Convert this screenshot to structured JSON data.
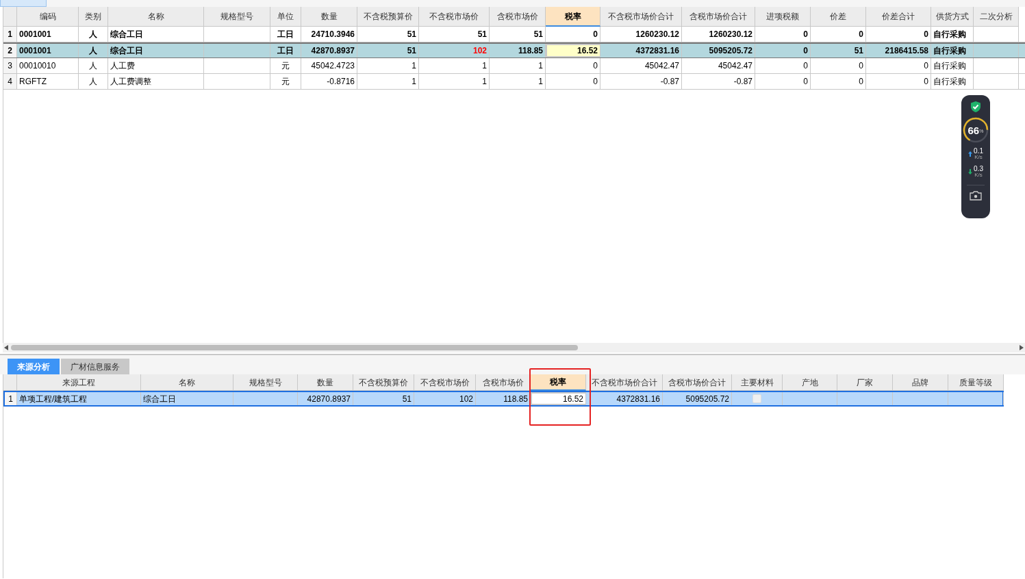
{
  "main_table": {
    "columns": [
      {
        "selected": false
      },
      {
        "label": "编码",
        "selected": false
      },
      {
        "label": "类别",
        "selected": false
      },
      {
        "label": "名称",
        "selected": false
      },
      {
        "label": "规格型号",
        "selected": false
      },
      {
        "label": "单位",
        "selected": false
      },
      {
        "label": "数量",
        "selected": false
      },
      {
        "label": "不含税预算价",
        "selected": false
      },
      {
        "label": "不含税市场价",
        "selected": false
      },
      {
        "label": "含税市场价",
        "selected": false
      },
      {
        "label": "税率",
        "selected": true
      },
      {
        "label": "不含税市场价合计",
        "selected": false
      },
      {
        "label": "含税市场价合计",
        "selected": false
      },
      {
        "label": "进项税额",
        "selected": false
      },
      {
        "label": "价差",
        "selected": false
      },
      {
        "label": "价差合计",
        "selected": false
      },
      {
        "label": "供货方式",
        "selected": false
      },
      {
        "label": "二次分析",
        "selected": false
      }
    ],
    "rows": [
      {
        "selected": false,
        "bold": true,
        "cells": [
          "1",
          "0001001",
          "人",
          "综合工日",
          "",
          "工日",
          "24710.3946",
          "51",
          "51",
          "51",
          "0",
          "1260230.12",
          "1260230.12",
          "0",
          "0",
          "0",
          "自行采购",
          ""
        ]
      },
      {
        "selected": true,
        "bold": true,
        "cells": [
          "2",
          "0001001",
          "人",
          "综合工日",
          "",
          "工日",
          "42870.8937",
          "51",
          {
            "text": "102",
            "color": "#ff0000"
          },
          "118.85",
          "16.52",
          "4372831.16",
          "5095205.72",
          "0",
          "51",
          "2186415.58",
          "自行采购",
          ""
        ]
      },
      {
        "selected": false,
        "bold": false,
        "cells": [
          "3",
          "00010010",
          "人",
          "人工费",
          "",
          "元",
          "45042.4723",
          "1",
          "1",
          "1",
          "0",
          "45042.47",
          "45042.47",
          "0",
          "0",
          "0",
          "自行采购",
          ""
        ]
      },
      {
        "selected": false,
        "bold": false,
        "cells": [
          "4",
          "RGFTZ",
          "人",
          "人工费调整",
          "",
          "元",
          "-0.8716",
          "1",
          "1",
          "1",
          "0",
          "-0.87",
          "-0.87",
          "0",
          "0",
          "0",
          "自行采购",
          ""
        ]
      }
    ]
  },
  "bottom_tabs": [
    {
      "label": "来源分析",
      "selected": true
    },
    {
      "label": "广材信息服务",
      "selected": false
    }
  ],
  "detail_table": {
    "columns": [
      {
        "selected": false
      },
      {
        "label": "来源工程",
        "selected": false
      },
      {
        "label": "名称",
        "selected": false
      },
      {
        "label": "规格型号",
        "selected": false
      },
      {
        "label": "数量",
        "selected": false
      },
      {
        "label": "不含税预算价",
        "selected": false
      },
      {
        "label": "不含税市场价",
        "selected": false
      },
      {
        "label": "含税市场价",
        "selected": false
      },
      {
        "label": "税率",
        "selected": true
      },
      {
        "label": "不含税市场价合计",
        "selected": false
      },
      {
        "label": "含税市场价合计",
        "selected": false
      },
      {
        "label": "主要材料",
        "selected": false
      },
      {
        "label": "产地",
        "selected": false
      },
      {
        "label": "厂家",
        "selected": false
      },
      {
        "label": "品牌",
        "selected": false
      },
      {
        "label": "质量等级",
        "selected": false
      }
    ],
    "rows": [
      {
        "selected": true,
        "cells": [
          "1",
          "单项工程/建筑工程",
          "综合工日",
          "",
          "42870.8937",
          "51",
          "102",
          "118.85",
          "16.52",
          "4372831.16",
          "5095205.72",
          {
            "kind": "checkbox",
            "checked": false
          },
          "",
          "",
          "",
          ""
        ]
      }
    ]
  },
  "monitor_widget": {
    "percent": "66",
    "unit": "%",
    "upload": "0.1",
    "upload_unit": "K/s",
    "download": "0.3",
    "download_unit": "K/s"
  }
}
